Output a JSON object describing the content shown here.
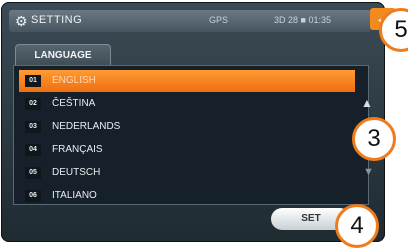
{
  "header": {
    "title": "SETTING",
    "gps_text": "GPS",
    "status_text": "3D 28 ■ 01:35",
    "back_icon": "arrow-left-icon"
  },
  "tab": {
    "label": "LANGUAGE"
  },
  "languages": [
    {
      "num": "01",
      "name": "ENGLISH",
      "selected": true
    },
    {
      "num": "02",
      "name": "ČEŠTINA",
      "selected": false
    },
    {
      "num": "03",
      "name": "NEDERLANDS",
      "selected": false
    },
    {
      "num": "04",
      "name": "FRANÇAIS",
      "selected": false
    },
    {
      "num": "05",
      "name": "DEUTSCH",
      "selected": false
    },
    {
      "num": "06",
      "name": "ITALIANO",
      "selected": false
    }
  ],
  "scroll": {
    "up_icon": "scroll-up-icon",
    "down_icon": "scroll-down-icon"
  },
  "set_button": {
    "label": "SET"
  },
  "callouts": {
    "c5": "5",
    "c3": "3",
    "c4": "4"
  },
  "colors": {
    "accent": "#f28a1f",
    "background": "#1f2a31"
  }
}
